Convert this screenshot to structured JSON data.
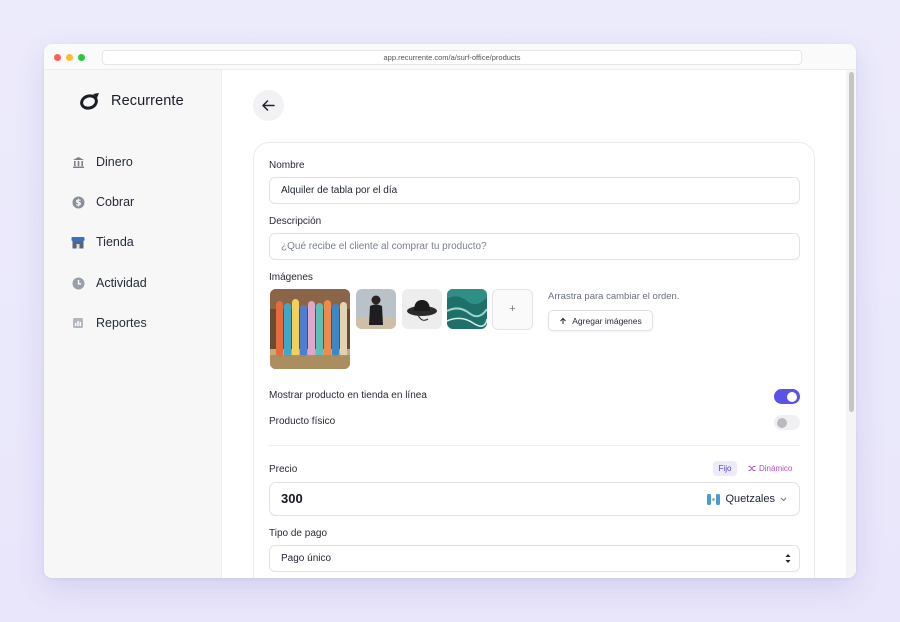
{
  "browser": {
    "url": "app.recurrente.com/a/surf-office/products"
  },
  "brand": {
    "name": "Recurrente"
  },
  "sidebar": {
    "items": [
      {
        "label": "Dinero",
        "icon": "bank-icon"
      },
      {
        "label": "Cobrar",
        "icon": "dollar-circle-icon"
      },
      {
        "label": "Tienda",
        "icon": "store-icon"
      },
      {
        "label": "Actividad",
        "icon": "clock-icon"
      },
      {
        "label": "Reportes",
        "icon": "report-icon"
      }
    ]
  },
  "form": {
    "name_label": "Nombre",
    "name_value": "Alquiler de tabla por el día",
    "description_label": "Descripción",
    "description_placeholder": "¿Qué recibe el cliente al comprar tu producto?",
    "images_label": "Imágenes",
    "images_hint": "Arrastra para cambiar el orden.",
    "add_images_label": "Agregar imágenes",
    "add_thumb_symbol": "+",
    "show_online_label": "Mostrar producto en tienda en línea",
    "show_online_enabled": true,
    "physical_label": "Producto físico",
    "physical_enabled": false,
    "price_label": "Precio",
    "price_mode_fixed": "Fijo",
    "price_mode_dynamic": "Dinámico",
    "price_value": "300",
    "currency": "Quetzales",
    "payment_type_label": "Tipo de pago",
    "payment_type_value": "Pago único"
  },
  "colors": {
    "accent": "#5b52e6",
    "dynamic": "#b04fc7"
  }
}
